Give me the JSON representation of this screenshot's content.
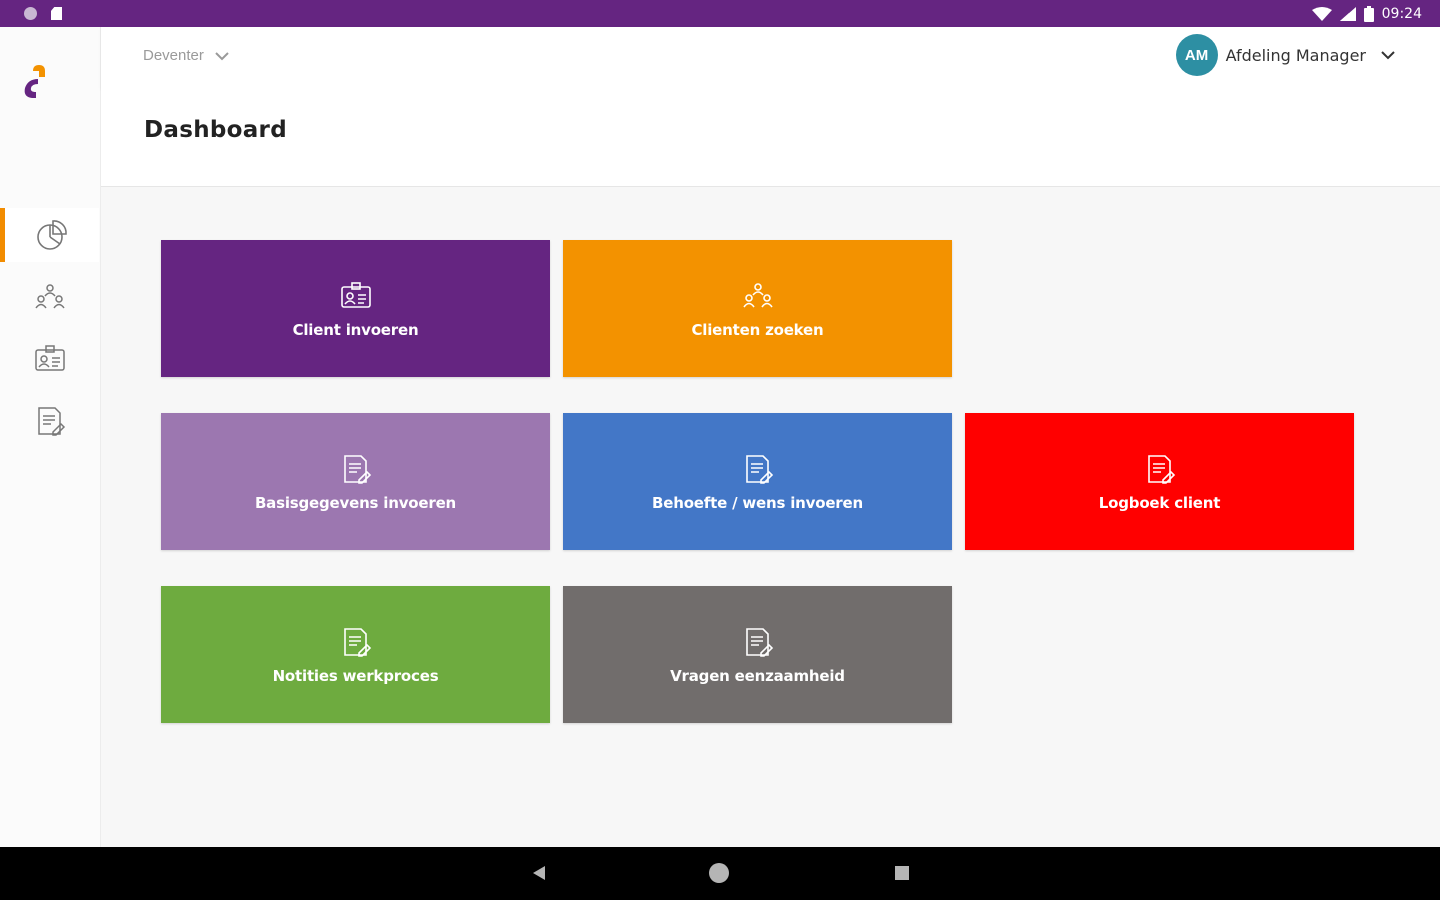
{
  "status_bar": {
    "time": "09:24",
    "icons": [
      "notification-icon",
      "sd-card-icon",
      "wifi-icon",
      "signal-icon",
      "battery-icon"
    ]
  },
  "header": {
    "location": "Deventer",
    "user": {
      "initials": "AM",
      "name": "Afdeling Manager"
    }
  },
  "page": {
    "title": "Dashboard"
  },
  "sidebar": {
    "items": [
      {
        "icon": "dashboard-pie-icon",
        "active": true
      },
      {
        "icon": "clients-group-icon",
        "active": false
      },
      {
        "icon": "client-card-icon",
        "active": false
      },
      {
        "icon": "notes-document-icon",
        "active": false
      }
    ]
  },
  "tiles": [
    {
      "label": "Client invoeren",
      "color": "#652581",
      "icon": "client-card-icon"
    },
    {
      "label": "Clienten zoeken",
      "color": "#f39200",
      "icon": "clients-group-icon"
    },
    {
      "label": "Basisgegevens invoeren",
      "color": "#9c77b0",
      "icon": "edit-document-icon"
    },
    {
      "label": "Behoefte / wens invoeren",
      "color": "#4377c7",
      "icon": "edit-document-icon"
    },
    {
      "label": "Logboek client",
      "color": "#ff0000",
      "icon": "edit-document-icon"
    },
    {
      "label": "Notities werkproces",
      "color": "#6eab3f",
      "icon": "edit-document-icon"
    },
    {
      "label": "Vragen eenzaamheid",
      "color": "#716d6c",
      "icon": "edit-document-icon"
    }
  ],
  "colors": {
    "brand_purple": "#652581",
    "brand_orange": "#f39200"
  }
}
